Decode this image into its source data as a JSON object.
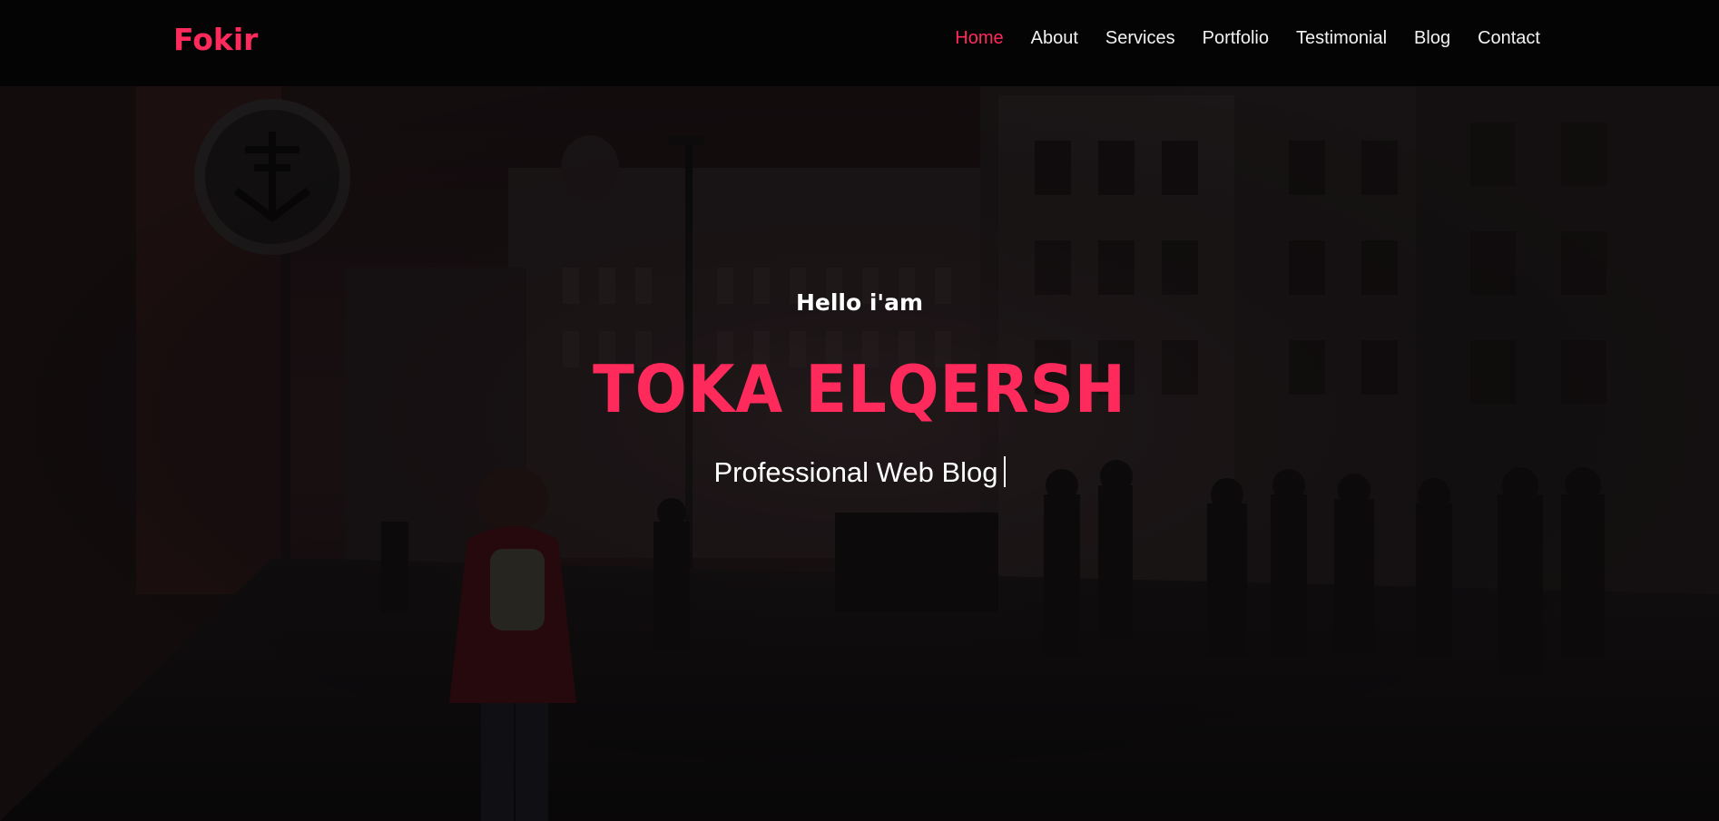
{
  "nav": {
    "brand": "Fokir",
    "links": [
      "Home",
      "About",
      "Services",
      "Portfolio",
      "Testimonial",
      "Blog",
      "Contact"
    ],
    "active_index": 0
  },
  "hero": {
    "greeting": "Hello i'am",
    "name": "TOKA ELQERSH",
    "tagline": "Professional Web Blog",
    "background": "dark-city-street-photo"
  },
  "colors": {
    "accent": "#ff2a5c",
    "navbar_bg": "#040404",
    "text": "#ffffff"
  }
}
